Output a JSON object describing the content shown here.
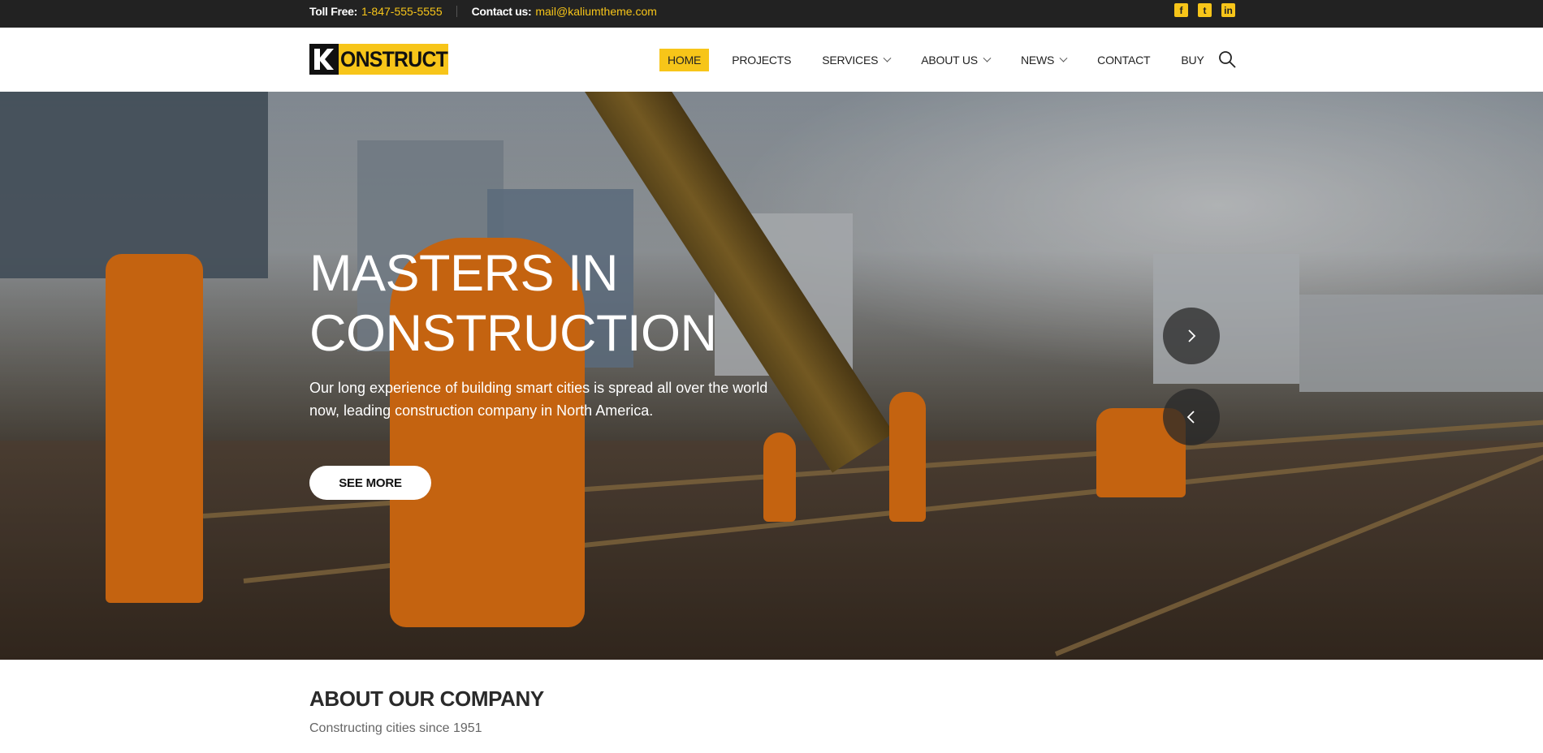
{
  "topbar": {
    "toll_free_label": "Toll Free:",
    "toll_free_number": "1-847-555-5555",
    "contact_label": "Contact us:",
    "contact_email": "mail@kaliumtheme.com",
    "social": [
      {
        "icon": "facebook-icon",
        "glyph": "f"
      },
      {
        "icon": "twitter-icon",
        "glyph": "t"
      },
      {
        "icon": "linkedin-icon",
        "glyph": "in"
      }
    ]
  },
  "logo": {
    "text": "ONSTRUCT",
    "letter": "K"
  },
  "nav": {
    "items": [
      {
        "label": "HOME",
        "active": true,
        "dropdown": false
      },
      {
        "label": "PROJECTS",
        "active": false,
        "dropdown": false
      },
      {
        "label": "SERVICES",
        "active": false,
        "dropdown": true
      },
      {
        "label": "ABOUT US",
        "active": false,
        "dropdown": true
      },
      {
        "label": "NEWS",
        "active": false,
        "dropdown": true
      },
      {
        "label": "CONTACT",
        "active": false,
        "dropdown": false
      },
      {
        "label": "BUY",
        "active": false,
        "dropdown": false
      }
    ]
  },
  "hero": {
    "title_line1": "MASTERS IN",
    "title_line2": "CONSTRUCTION",
    "text": "Our long experience of building smart cities is spread all over the world now, leading construction company in North America.",
    "button": "SEE MORE"
  },
  "about": {
    "title": "ABOUT OUR COMPANY",
    "subtitle": "Constructing cities since 1951"
  },
  "colors": {
    "accent": "#f7c519",
    "topbar_bg": "#222222"
  }
}
